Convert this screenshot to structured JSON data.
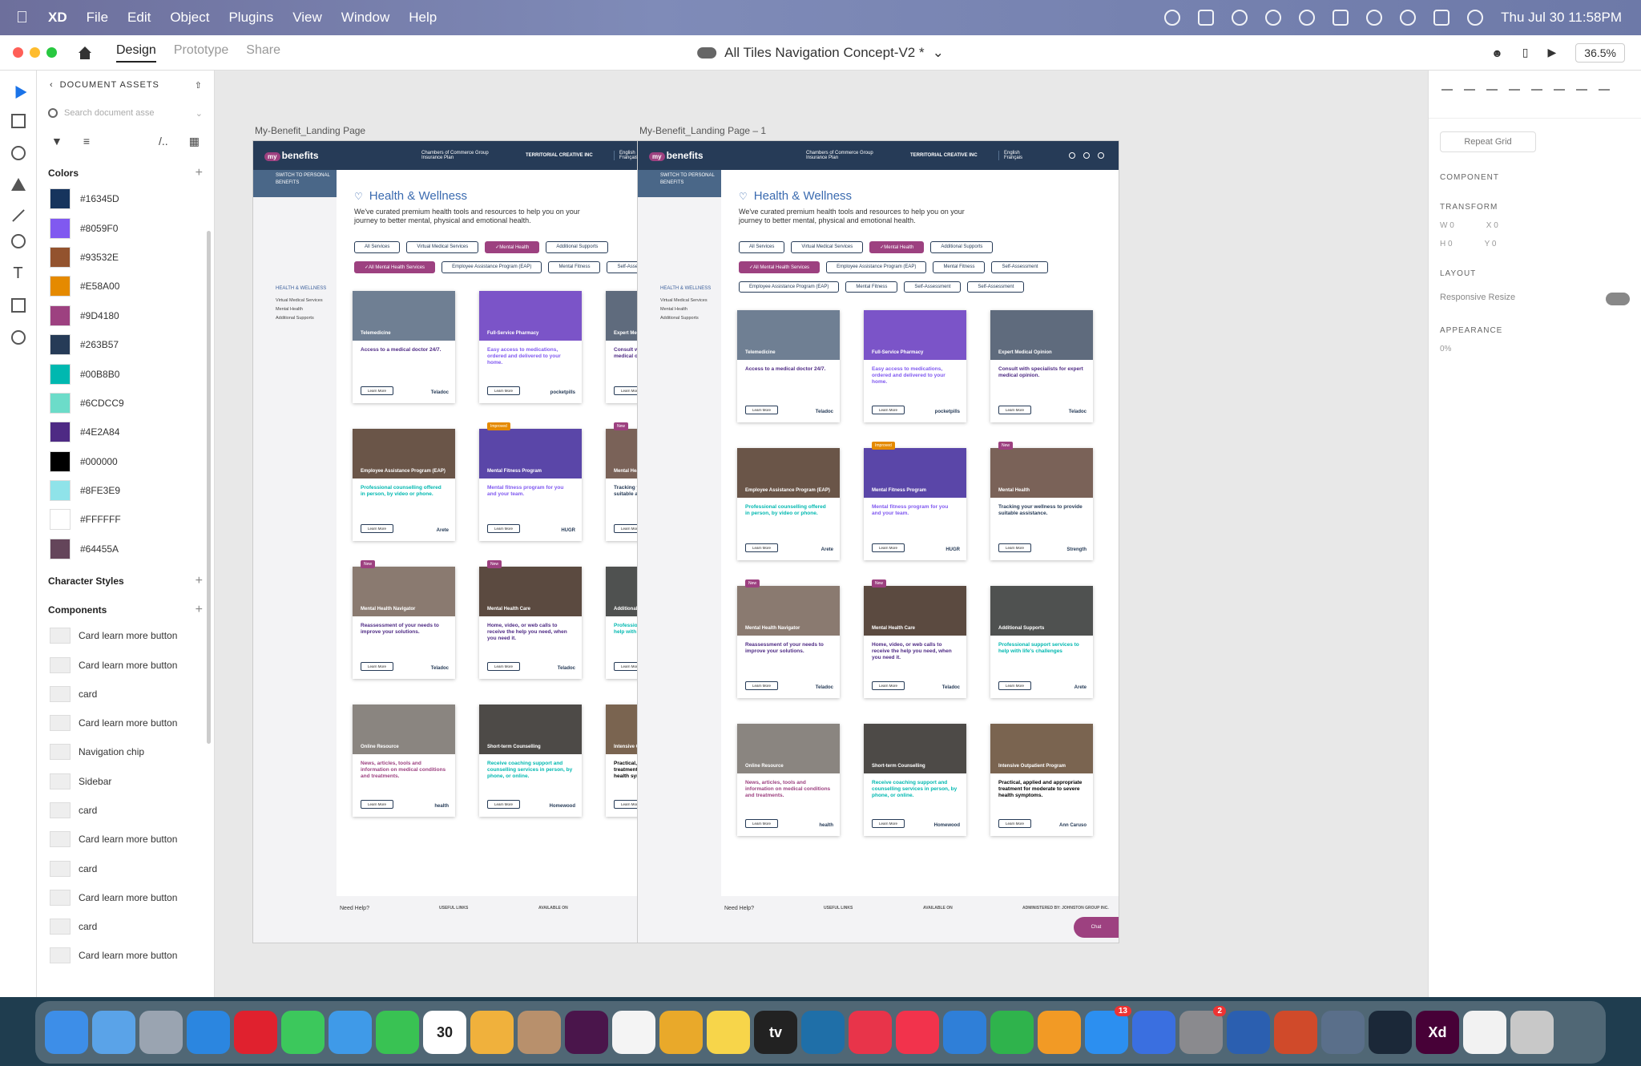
{
  "menubar": {
    "app": "XD",
    "items": [
      "File",
      "Edit",
      "Object",
      "Plugins",
      "View",
      "Window",
      "Help"
    ],
    "clock": "Thu Jul 30  11:58PM"
  },
  "titlebar": {
    "tabs": [
      "Design",
      "Prototype",
      "Share"
    ],
    "document": "All Tiles Navigation Concept-V2 *",
    "zoom": "36.5%"
  },
  "assets": {
    "title": "DOCUMENT ASSETS",
    "search_placeholder": "Search document asse",
    "colors_label": "Colors",
    "colors": [
      "#16345D",
      "#8059F0",
      "#93532E",
      "#E58A00",
      "#9D4180",
      "#263B57",
      "#00B8B0",
      "#6CDCC9",
      "#4E2A84",
      "#000000",
      "#8FE3E9",
      "#FFFFFF",
      "#64455A"
    ],
    "character_styles_label": "Character Styles",
    "components_label": "Components",
    "components": [
      "Card learn more button",
      "Card learn more button",
      "card",
      "Card learn more button",
      "Navigation chip",
      "Sidebar",
      "card",
      "Card learn more button",
      "card",
      "Card learn more button",
      "card",
      "Card learn more button"
    ]
  },
  "artboards": [
    {
      "label": "My-Benefit_Landing Page",
      "header": {
        "logo": "benefits",
        "logo_prefix": "my",
        "coc": "Chambers of Commerce Group Insurance Plan",
        "territorial": "TERRITORIAL CREATIVE INC",
        "lang_english": "English",
        "lang_french": "Français"
      },
      "sidebar": {
        "switch": "SWITCH TO PERSONAL BENEFITS",
        "nav_head": "HEALTH & WELLNESS",
        "nav_items": [
          "Virtual Medical Services",
          "Mental Health",
          "Additional Supports"
        ]
      },
      "title": "Health & Wellness",
      "desc": "We've curated premium health tools and resources to help you on your journey to better mental, physical and emotional health.",
      "chips_row1": [
        "All Services",
        "Virtual Medical Services",
        "Mental Health",
        "Additional Supports"
      ],
      "chips_row2": [
        "All Mental Health Services",
        "Employee Assistance Program (EAP)",
        "Mental Fitness",
        "Self-Assessment"
      ],
      "chips_row3": []
    },
    {
      "label": "My-Benefit_Landing Page – 1",
      "header": {
        "logo": "benefits",
        "logo_prefix": "my",
        "coc": "Chambers of Commerce Group Insurance Plan",
        "territorial": "TERRITORIAL CREATIVE INC",
        "lang_english": "English",
        "lang_french": "Français"
      },
      "sidebar": {
        "switch": "SWITCH TO PERSONAL BENEFITS",
        "nav_head": "HEALTH & WELLNESS",
        "nav_items": [
          "Virtual Medical Services",
          "Mental Health",
          "Additional Supports"
        ]
      },
      "title": "Health & Wellness",
      "desc": "We've curated premium health tools and resources to help you on your journey to better mental, physical and emotional health.",
      "chips_row1": [
        "All Services",
        "Virtual Medical Services",
        "Mental Health",
        "Additional Supports"
      ],
      "chips_row2": [
        "All Mental Health Services",
        "Employee Assistance Program (EAP)",
        "Mental Fitness",
        "Self-Assessment"
      ],
      "chips_row3": [
        "Employee Assistance Program (EAP)",
        "Mental Fitness",
        "Self-Assessment",
        "Self-Assessment"
      ]
    }
  ],
  "cards": [
    {
      "title": "Telemedicine",
      "desc": "Access to a medical doctor 24/7.",
      "color": "#4E2A84",
      "brand": "Teladoc",
      "img": "#6f7f93",
      "badge": ""
    },
    {
      "title": "Full-Service Pharmacy",
      "desc": "Easy access to medications, ordered and delivered to your home.",
      "color": "#8059F0",
      "brand": "pocketpills",
      "img": "#7b54c8",
      "badge": ""
    },
    {
      "title": "Expert Medical Opinion",
      "desc": "Consult with specialists for expert medical opinion.",
      "color": "#4E2A84",
      "brand": "Teladoc",
      "img": "#5f6b7d",
      "badge": ""
    },
    {
      "title": "Employee Assistance Program (EAP)",
      "desc": "Professional counselling offered in person, by video or phone.",
      "color": "#00B8B0",
      "brand": "Arete",
      "img": "#6a5548",
      "badge": ""
    },
    {
      "title": "Mental Fitness Program",
      "desc": "Mental fitness program for you and your team.",
      "color": "#8059F0",
      "brand": "HUGR",
      "img": "#5a46a8",
      "badge": "Improved"
    },
    {
      "title": "Mental Health",
      "desc": "Tracking your wellness to provide suitable assistance.",
      "color": "#263B57",
      "brand": "Strength",
      "img": "#7a6258",
      "badge": "New"
    },
    {
      "title": "Mental Health Navigator",
      "desc": "Reassessment of your needs to improve your solutions.",
      "color": "#4E2A84",
      "brand": "Teladoc",
      "img": "#8a7a70",
      "badge": "New"
    },
    {
      "title": "Mental Health Care",
      "desc": "Home, video, or web calls to receive the help you need, when you need it.",
      "color": "#4E2A84",
      "brand": "Teladoc",
      "img": "#5b4a40",
      "badge": "New"
    },
    {
      "title": "Additional Supports",
      "desc": "Professional support services to help with life's challenges",
      "color": "#00B8B0",
      "brand": "Arete",
      "img": "#4f5150",
      "badge": ""
    },
    {
      "title": "Online Resource",
      "desc": "News, articles, tools and information on medical conditions and treatments.",
      "color": "#9D4180",
      "brand": "health",
      "img": "#8a8580",
      "badge": ""
    },
    {
      "title": "Short-term Counselling",
      "desc": "Receive coaching support and counselling services in person, by phone, or online.",
      "color": "#00B8B0",
      "brand": "Homewood",
      "img": "#4d4a47",
      "badge": ""
    },
    {
      "title": "Intensive Outpatient Program",
      "desc": "Practical, applied and appropriate treatment for moderate to severe health symptoms.",
      "color": "#000000",
      "brand": "Ann Caruso",
      "img": "#7a6450",
      "badge": ""
    }
  ],
  "card_button": "Learn More",
  "footer": {
    "need_help": "Need Help?",
    "useful": "USEFUL LINKS",
    "available": "AVAILABLE ON",
    "admin": "ADMINISTERED BY: JOHNSTON GROUP INC.",
    "chat": "Chat"
  },
  "props": {
    "repeat_grid": "Repeat Grid",
    "component": "COMPONENT",
    "transform": "TRANSFORM",
    "w": "W",
    "w_val": "0",
    "x": "X",
    "x_val": "0",
    "h": "H",
    "h_val": "0",
    "y": "Y",
    "y_val": "0",
    "layout": "LAYOUT",
    "responsive": "Responsive Resize",
    "appearance": "APPEARANCE",
    "opacity": "0%"
  },
  "dock": [
    {
      "name": "finder",
      "color": "#3d8ee8"
    },
    {
      "name": "tools",
      "color": "#5aa3e8"
    },
    {
      "name": "launchpad",
      "color": "#9aa4b1"
    },
    {
      "name": "safari",
      "color": "#2b86e0"
    },
    {
      "name": "opera",
      "color": "#e0212e"
    },
    {
      "name": "messages",
      "color": "#3cc85c"
    },
    {
      "name": "mail",
      "color": "#3f9ae8"
    },
    {
      "name": "facetime",
      "color": "#39c253"
    },
    {
      "name": "calendar",
      "color": "#ffffff",
      "label": "30"
    },
    {
      "name": "photos",
      "color": "#f0b13c"
    },
    {
      "name": "contacts",
      "color": "#b8906c"
    },
    {
      "name": "slack",
      "color": "#4a154b"
    },
    {
      "name": "reminders",
      "color": "#f4f4f4"
    },
    {
      "name": "chrome",
      "color": "#e9a92a"
    },
    {
      "name": "notes",
      "color": "#f7d54a"
    },
    {
      "name": "appletv",
      "color": "#222222",
      "label": "tv"
    },
    {
      "name": "freeform",
      "color": "#1f6fa8"
    },
    {
      "name": "news",
      "color": "#e8344a"
    },
    {
      "name": "music",
      "color": "#f2334c"
    },
    {
      "name": "keynote",
      "color": "#2f7fd8"
    },
    {
      "name": "numbers",
      "color": "#2fb34c"
    },
    {
      "name": "pages",
      "color": "#f29a25"
    },
    {
      "name": "appstore",
      "color": "#2c8ff0",
      "badge": "13"
    },
    {
      "name": "simulator",
      "color": "#3a6fe0"
    },
    {
      "name": "system-preferences",
      "color": "#8a8a8e",
      "badge": "2"
    },
    {
      "name": "word",
      "color": "#2b5fb0"
    },
    {
      "name": "powerpoint",
      "color": "#d04a2a"
    },
    {
      "name": "migration",
      "color": "#5a6f8a"
    },
    {
      "name": "steam",
      "color": "#1b2838"
    },
    {
      "name": "xd",
      "color": "#470137",
      "label": "Xd"
    },
    {
      "name": "document",
      "color": "#f2f2f2"
    },
    {
      "name": "trash",
      "color": "#c8c8c8"
    }
  ]
}
